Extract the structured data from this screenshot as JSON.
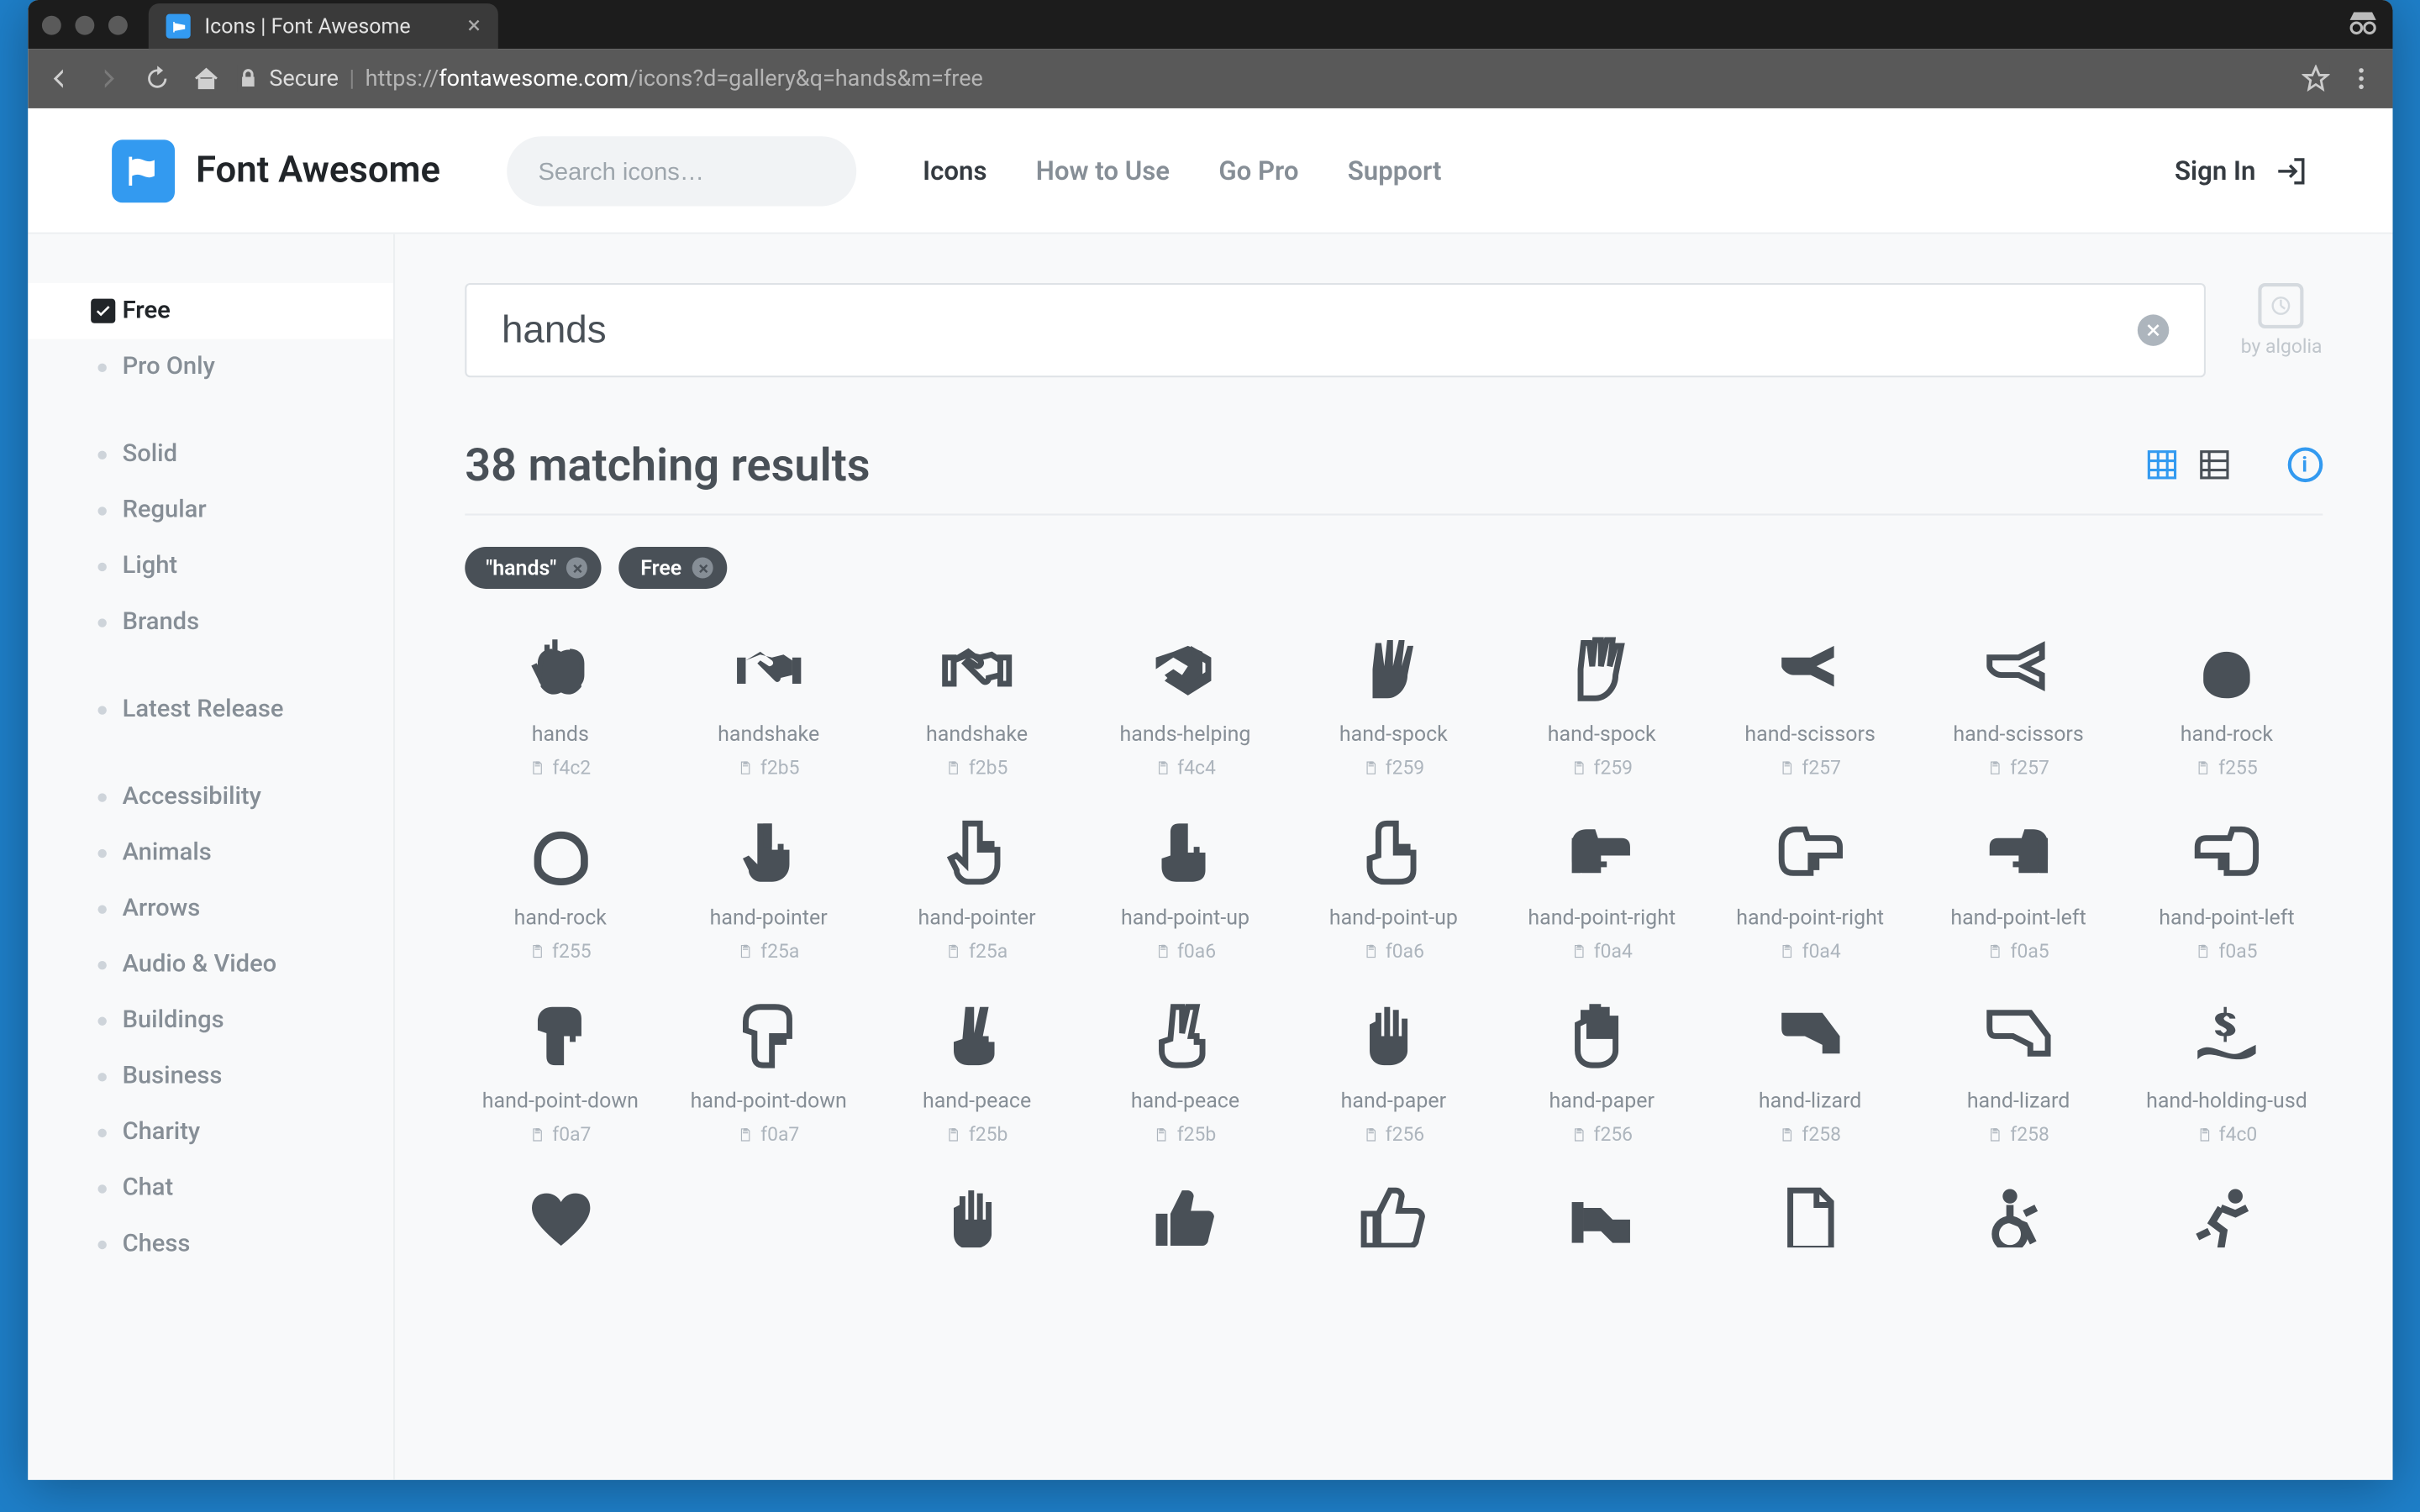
{
  "browser": {
    "tab_title": "Icons | Font Awesome",
    "secure_label": "Secure",
    "url_scheme": "https://",
    "url_host": "fontawesome.com",
    "url_path": "/icons?d=gallery&q=hands&m=free"
  },
  "nav": {
    "brand": "Font Awesome",
    "search_placeholder": "Search icons…",
    "links": [
      "Icons",
      "How to Use",
      "Go Pro",
      "Support"
    ],
    "sign_in": "Sign In"
  },
  "sidebar": {
    "filters": [
      {
        "label": "Free",
        "active": true
      },
      {
        "label": "Pro Only"
      }
    ],
    "styles": [
      {
        "label": "Solid"
      },
      {
        "label": "Regular"
      },
      {
        "label": "Light"
      },
      {
        "label": "Brands"
      }
    ],
    "release": [
      {
        "label": "Latest Release"
      }
    ],
    "categories": [
      {
        "label": "Accessibility"
      },
      {
        "label": "Animals"
      },
      {
        "label": "Arrows"
      },
      {
        "label": "Audio & Video"
      },
      {
        "label": "Buildings"
      },
      {
        "label": "Business"
      },
      {
        "label": "Charity"
      },
      {
        "label": "Chat"
      },
      {
        "label": "Chess"
      }
    ]
  },
  "search": {
    "query": "hands",
    "algolia": "by algolia",
    "results_label": "38 matching results"
  },
  "chips": [
    "\"hands\"",
    "Free"
  ],
  "icons": [
    {
      "name": "hands",
      "code": "f4c2",
      "svg": "hands"
    },
    {
      "name": "handshake",
      "code": "f2b5",
      "svg": "handshake-s"
    },
    {
      "name": "handshake",
      "code": "f2b5",
      "svg": "handshake-o"
    },
    {
      "name": "hands-helping",
      "code": "f4c4",
      "svg": "helping"
    },
    {
      "name": "hand-spock",
      "code": "f259",
      "svg": "spock-s"
    },
    {
      "name": "hand-spock",
      "code": "f259",
      "svg": "spock-o"
    },
    {
      "name": "hand-scissors",
      "code": "f257",
      "svg": "scissors-s"
    },
    {
      "name": "hand-scissors",
      "code": "f257",
      "svg": "scissors-o"
    },
    {
      "name": "hand-rock",
      "code": "f255",
      "svg": "rock-s"
    },
    {
      "name": "hand-rock",
      "code": "f255",
      "svg": "rock-o"
    },
    {
      "name": "hand-pointer",
      "code": "f25a",
      "svg": "pointer-s"
    },
    {
      "name": "hand-pointer",
      "code": "f25a",
      "svg": "pointer-o"
    },
    {
      "name": "hand-point-up",
      "code": "f0a6",
      "svg": "point-up-s"
    },
    {
      "name": "hand-point-up",
      "code": "f0a6",
      "svg": "point-up-o"
    },
    {
      "name": "hand-point-right",
      "code": "f0a4",
      "svg": "point-right-s"
    },
    {
      "name": "hand-point-right",
      "code": "f0a4",
      "svg": "point-right-o"
    },
    {
      "name": "hand-point-left",
      "code": "f0a5",
      "svg": "point-left-s"
    },
    {
      "name": "hand-point-left",
      "code": "f0a5",
      "svg": "point-left-o"
    },
    {
      "name": "hand-point-down",
      "code": "f0a7",
      "svg": "point-down-s"
    },
    {
      "name": "hand-point-down",
      "code": "f0a7",
      "svg": "point-down-o"
    },
    {
      "name": "hand-peace",
      "code": "f25b",
      "svg": "peace-s"
    },
    {
      "name": "hand-peace",
      "code": "f25b",
      "svg": "peace-o"
    },
    {
      "name": "hand-paper",
      "code": "f256",
      "svg": "paper-s"
    },
    {
      "name": "hand-paper",
      "code": "f256",
      "svg": "paper-o"
    },
    {
      "name": "hand-lizard",
      "code": "f258",
      "svg": "lizard-s"
    },
    {
      "name": "hand-lizard",
      "code": "f258",
      "svg": "lizard-o"
    },
    {
      "name": "hand-holding-usd",
      "code": "f4c0",
      "svg": "holding-usd"
    }
  ],
  "icons_partial": [
    {
      "svg": "heart"
    },
    {
      "svg": "blank"
    },
    {
      "svg": "paper-s"
    },
    {
      "svg": "thumb-s"
    },
    {
      "svg": "thumb-o"
    },
    {
      "svg": "binoc"
    },
    {
      "svg": "file"
    },
    {
      "svg": "wheel"
    },
    {
      "svg": "run"
    }
  ]
}
